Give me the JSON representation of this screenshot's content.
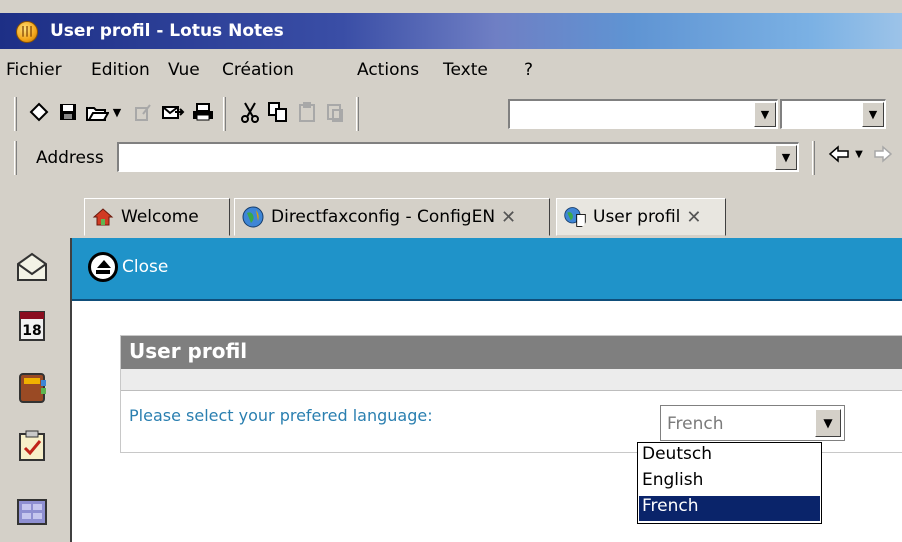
{
  "window": {
    "title": "User profil - Lotus Notes"
  },
  "menu": [
    "Fichier",
    "Edition",
    "Vue",
    "Création",
    "Actions",
    "Texte",
    "?"
  ],
  "address": {
    "label": "Address",
    "value": ""
  },
  "tabs": [
    {
      "label": "Welcome",
      "icon": "home-icon",
      "closable": false
    },
    {
      "label": "Directfaxconfig - ConfigEN",
      "icon": "globe-icon",
      "closable": true
    },
    {
      "label": "User profil",
      "icon": "globe-doc-icon",
      "closable": true,
      "active": true
    }
  ],
  "action_bar": {
    "close_label": "Close",
    "color": "#1f93c9"
  },
  "form": {
    "title": "User profil",
    "language_prompt": "Please select your prefered language:",
    "language_value": "French",
    "language_options": [
      "Deutsch",
      "English",
      "French"
    ],
    "selected_option": "French"
  },
  "sidebar_icons": [
    "mail-icon",
    "calendar-icon",
    "address-book-icon",
    "todo-icon",
    "database-icon"
  ]
}
